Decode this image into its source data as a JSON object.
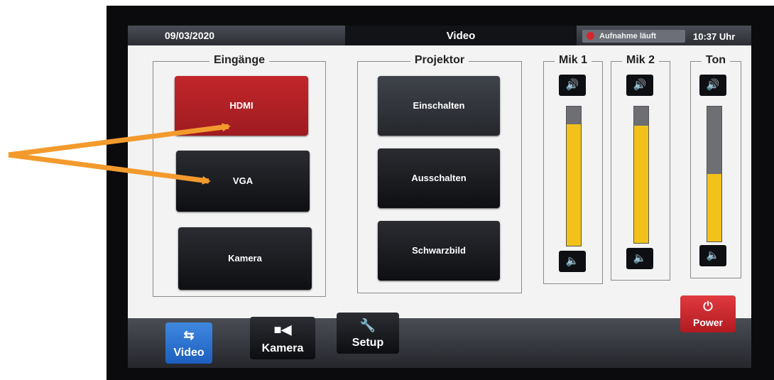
{
  "status": {
    "date": "09/03/2020",
    "title": "Video",
    "recording": "Aufnahme läuft",
    "time": "10:37 Uhr"
  },
  "inputs": {
    "label": "Eingänge",
    "buttons": [
      "HDMI",
      "VGA",
      "Kamera"
    ],
    "selected": "HDMI"
  },
  "projector": {
    "label": "Projektor",
    "buttons": [
      "Einschalten",
      "Ausschalten",
      "Schwarzbild"
    ]
  },
  "audio": [
    {
      "label": "Mik 1",
      "level": 0.87
    },
    {
      "label": "Mik 2",
      "level": 0.86
    },
    {
      "label": "Ton",
      "level": 0.5
    }
  ],
  "nav": {
    "items": [
      "Video",
      "Kamera",
      "Setup"
    ],
    "selected": "Video",
    "power": "Power"
  },
  "colors": {
    "active_input": "#b52025",
    "nav_selected": "#2a70d2",
    "meter_fill": "#f3c21a",
    "power": "#c8252b",
    "arrow": "#f39a2d"
  }
}
